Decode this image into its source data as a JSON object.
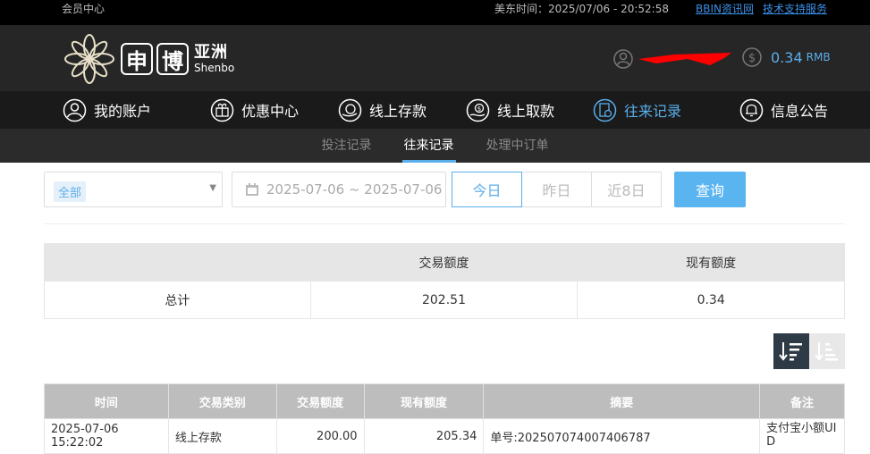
{
  "topbar": {
    "member_center": "会员中心",
    "time": "美东时间：2025/07/06 - 20:52:58",
    "link_bbin": "BBIN资讯网",
    "link_support": "技术支持服务"
  },
  "logo": {
    "char1": "申",
    "char2": "博",
    "cn": "亚洲",
    "en": "Shenbo"
  },
  "account": {
    "balance": "0.34",
    "currency": "RMB"
  },
  "nav": {
    "items": [
      {
        "label": "我的账户",
        "icon": "user-circle-icon"
      },
      {
        "label": "优惠中心",
        "icon": "gift-icon"
      },
      {
        "label": "线上存款",
        "icon": "deposit-icon"
      },
      {
        "label": "线上取款",
        "icon": "withdraw-icon"
      },
      {
        "label": "往来记录",
        "icon": "records-icon"
      },
      {
        "label": "信息公告",
        "icon": "bell-icon"
      }
    ],
    "active_index": 4
  },
  "subnav": {
    "items": [
      "投注记录",
      "往来记录",
      "处理中订单"
    ],
    "active_index": 1
  },
  "filters": {
    "type_selected": "全部",
    "date_range": "2025-07-06 ~ 2025-07-06",
    "quick": [
      "今日",
      "昨日",
      "近8日"
    ],
    "quick_active_index": 0,
    "query_label": "查询"
  },
  "summary": {
    "headers": [
      "",
      "交易额度",
      "现有额度"
    ],
    "row": [
      "总计",
      "202.51",
      "0.34"
    ]
  },
  "detail": {
    "headers": [
      "时间",
      "交易类别",
      "交易额度",
      "现有额度",
      "摘要",
      "备注"
    ],
    "rows": [
      [
        "2025-07-06 15:22:02",
        "线上存款",
        "200.00",
        "205.34",
        "单号:202507074007406787",
        "支付宝小额UID"
      ]
    ]
  },
  "colors": {
    "accent": "#5aaeea",
    "header_bg": "#262626",
    "nav_bg": "#1a1a1a",
    "redaction": "#ff0000"
  }
}
